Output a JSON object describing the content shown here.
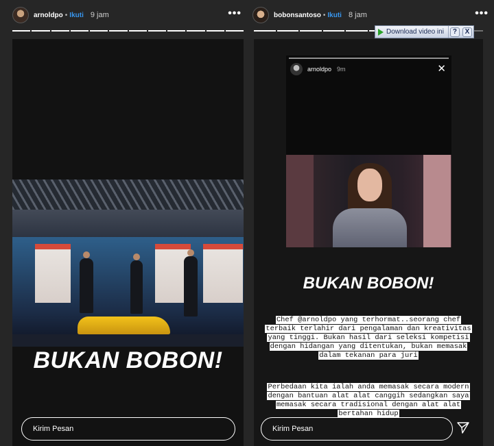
{
  "story_left": {
    "username": "arnoldpo",
    "separator": "•",
    "follow_label": "Ikuti",
    "time": "9 jam",
    "more_label": "•••",
    "progress_segments": [
      1,
      1,
      1,
      1,
      1,
      1,
      1,
      1,
      1,
      1,
      1,
      1
    ],
    "headline": "BUKAN BOBON!",
    "reply_placeholder": "Kirim Pesan"
  },
  "story_right": {
    "username": "bobonsantoso",
    "separator": "•",
    "follow_label": "Ikuti",
    "time": "8 jam",
    "more_label": "•••",
    "progress_segments": [
      1,
      1,
      1,
      1,
      1,
      1,
      0,
      0,
      0,
      0
    ],
    "inner_story": {
      "username": "arnoldpo",
      "time": "9m",
      "close_label": "✕"
    },
    "headline": "BUKAN BOBON!",
    "caption_1": "Chef @arnoldpo yang terhormat..seorang chef terbaik terlahir dari pengalaman dan kreativitas yang tinggi. Bukan hasil dari seleksi kompetisi dengan hidangan yang ditentukan, bukan memasak dalam tekanan para juri",
    "caption_2": "Perbedaan kita ialah anda memasak secara modern dengan bantuan alat alat canggih sedangkan saya memasak secara tradisional dengan alat alat bertahan hidup",
    "reply_placeholder": "Kirim Pesan"
  },
  "download_bar": {
    "label": "Download video ini",
    "help_label": "?",
    "close_label": "X"
  },
  "colors": {
    "background": "#262626",
    "follow": "#3897f0",
    "caption_bg": "#ffffff"
  },
  "icons": [
    "more-icon",
    "close-icon",
    "send-icon",
    "play-icon"
  ]
}
